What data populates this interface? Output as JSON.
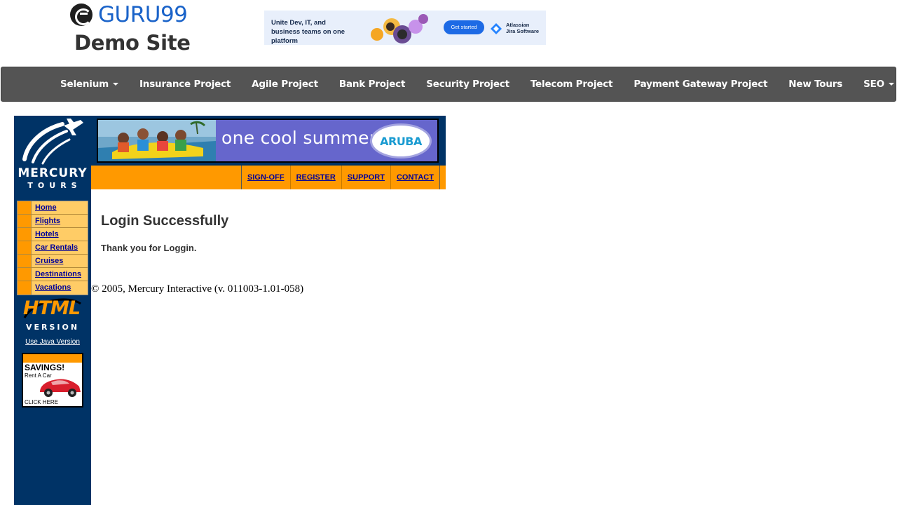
{
  "brand": {
    "name": "GURU99",
    "subtitle": "Demo Site",
    "colors": {
      "name": "#1a63c9",
      "subtitle": "#333333"
    }
  },
  "ad": {
    "headline": "Unite Dev, IT, and business teams on one platform",
    "cta": "Get started",
    "brand_line1": "Atlassian",
    "brand_line2": "Jira Software",
    "icon": "jira-icon"
  },
  "navbar": {
    "background": "#545454",
    "items": [
      {
        "label": "Selenium",
        "dropdown": true
      },
      {
        "label": "Insurance Project",
        "dropdown": false
      },
      {
        "label": "Agile Project",
        "dropdown": false
      },
      {
        "label": "Bank Project",
        "dropdown": false
      },
      {
        "label": "Security Project",
        "dropdown": false
      },
      {
        "label": "Telecom Project",
        "dropdown": false
      },
      {
        "label": "Payment Gateway Project",
        "dropdown": false
      },
      {
        "label": "New Tours",
        "dropdown": false
      },
      {
        "label": "SEO",
        "dropdown": true
      }
    ]
  },
  "mercury": {
    "colors": {
      "navy": "#003366",
      "orange": "#ff9900",
      "menu": "#ffcc66",
      "link": "#000099"
    },
    "logo_line1": "MERCURY",
    "logo_line2": "TOURS",
    "side_menu": [
      "Home",
      "Flights",
      "Hotels",
      "Car Rentals",
      "Cruises",
      "Destinations",
      "Vacations"
    ],
    "html_version_big": "HTML",
    "html_version_sub": "VERSION",
    "java_link": "Use Java Version",
    "savings_title": "SAVINGS!",
    "savings_sub": "Rent A Car",
    "savings_click": "CLICK HERE",
    "banner_text": "one cool summer",
    "banner_logo": "ARUBA",
    "top_nav": [
      "SIGN-OFF",
      "REGISTER",
      "SUPPORT",
      "CONTACT"
    ],
    "heading": "Login Successfully",
    "message": "Thank you for Loggin.",
    "footer": "© 2005, Mercury Interactive (v. 011003-1.01-058)"
  }
}
